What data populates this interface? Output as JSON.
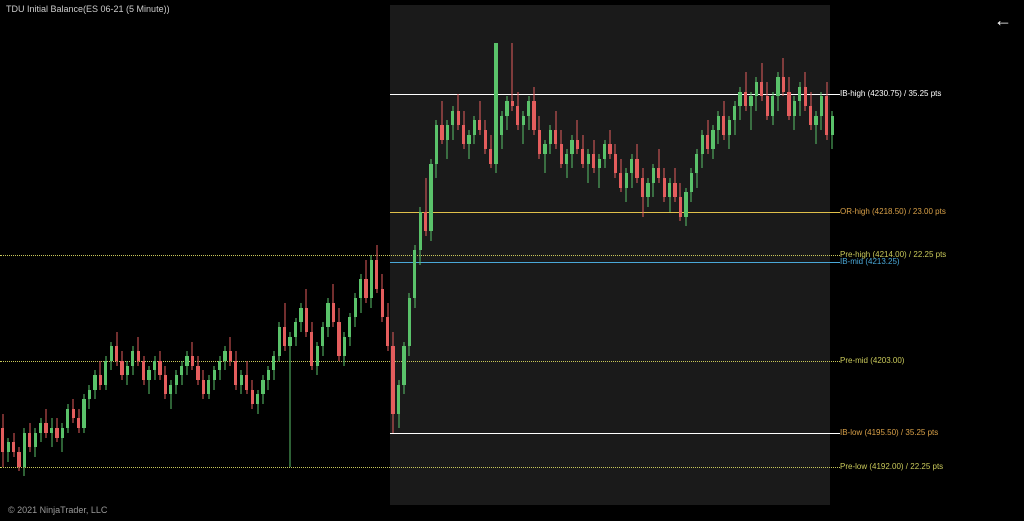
{
  "title": "TDU Initial Balance(ES 06-21 (5 Minute))",
  "copyright": "© 2021 NinjaTrader, LLC",
  "back_icon": "←",
  "chart_data": {
    "type": "candlestick",
    "instrument": "ES 06-21",
    "timeframe": "5 Minute",
    "price_top": 4240.0,
    "price_bottom": 4188.0,
    "session_highlight": {
      "start_idx": 72,
      "end_idx": 152
    },
    "lines": [
      {
        "id": "ib-high",
        "label": "IB-high (4230.75) / 35.25 pts",
        "price": 4230.75,
        "style": "solid",
        "color": "#ffffff",
        "from_idx": 72,
        "to_idx": 160,
        "label_color": "#ffffff"
      },
      {
        "id": "or-high",
        "label": "OR-high (4218.50) / 23.00 pts",
        "price": 4218.5,
        "style": "solid",
        "color": "#e0c04a",
        "from_idx": 72,
        "to_idx": 160,
        "label_color": "#d8a048"
      },
      {
        "id": "pre-high",
        "label": "Pre-high (4214.00) / 22.25 pts",
        "price": 4214.0,
        "style": "dotted",
        "color": "#c9c95a",
        "from_idx": 0,
        "to_idx": 160,
        "label_color": "#c9c95a"
      },
      {
        "id": "ib-mid",
        "label": "IB-mid (4213.25)",
        "price": 4213.25,
        "style": "solid",
        "color": "#4aa8d8",
        "from_idx": 72,
        "to_idx": 160,
        "label_color": "#4aa8d8"
      },
      {
        "id": "pre-mid",
        "label": "Pre-mid (4203.00)",
        "price": 4203.0,
        "style": "dotted",
        "color": "#c9c95a",
        "from_idx": 0,
        "to_idx": 160,
        "label_color": "#c9c95a"
      },
      {
        "id": "ib-low",
        "label": "IB-low (4195.50) / 35.25 pts",
        "price": 4195.5,
        "style": "solid",
        "color": "#ffffff",
        "from_idx": 72,
        "to_idx": 160,
        "label_color": "#d8a048"
      },
      {
        "id": "pre-low",
        "label": "Pre-low (4192.00) / 22.25 pts",
        "price": 4192.0,
        "style": "dotted",
        "color": "#c9c95a",
        "from_idx": 0,
        "to_idx": 160,
        "label_color": "#c9c95a"
      }
    ],
    "candles": [
      {
        "o": 4196.0,
        "h": 4197.5,
        "l": 4192.0,
        "c": 4193.5
      },
      {
        "o": 4193.5,
        "h": 4195.0,
        "l": 4192.5,
        "c": 4194.5
      },
      {
        "o": 4194.5,
        "h": 4195.5,
        "l": 4193.0,
        "c": 4193.5
      },
      {
        "o": 4193.5,
        "h": 4194.0,
        "l": 4191.5,
        "c": 4192.0
      },
      {
        "o": 4192.0,
        "h": 4196.0,
        "l": 4191.0,
        "c": 4195.5
      },
      {
        "o": 4195.5,
        "h": 4196.5,
        "l": 4193.5,
        "c": 4194.0
      },
      {
        "o": 4194.0,
        "h": 4196.0,
        "l": 4193.0,
        "c": 4195.5
      },
      {
        "o": 4195.5,
        "h": 4197.0,
        "l": 4194.5,
        "c": 4196.5
      },
      {
        "o": 4196.5,
        "h": 4198.0,
        "l": 4195.0,
        "c": 4195.5
      },
      {
        "o": 4195.5,
        "h": 4197.0,
        "l": 4194.0,
        "c": 4196.0
      },
      {
        "o": 4196.0,
        "h": 4197.0,
        "l": 4194.5,
        "c": 4195.0
      },
      {
        "o": 4195.0,
        "h": 4196.5,
        "l": 4193.5,
        "c": 4196.0
      },
      {
        "o": 4196.0,
        "h": 4198.5,
        "l": 4195.5,
        "c": 4198.0
      },
      {
        "o": 4198.0,
        "h": 4199.0,
        "l": 4196.5,
        "c": 4197.0
      },
      {
        "o": 4197.0,
        "h": 4198.0,
        "l": 4195.5,
        "c": 4196.0
      },
      {
        "o": 4196.0,
        "h": 4199.5,
        "l": 4195.5,
        "c": 4199.0
      },
      {
        "o": 4199.0,
        "h": 4200.5,
        "l": 4198.0,
        "c": 4200.0
      },
      {
        "o": 4200.0,
        "h": 4202.0,
        "l": 4199.0,
        "c": 4201.5
      },
      {
        "o": 4201.5,
        "h": 4203.0,
        "l": 4200.0,
        "c": 4200.5
      },
      {
        "o": 4200.5,
        "h": 4203.5,
        "l": 4200.0,
        "c": 4203.0
      },
      {
        "o": 4203.0,
        "h": 4205.0,
        "l": 4202.0,
        "c": 4204.5
      },
      {
        "o": 4204.5,
        "h": 4206.0,
        "l": 4202.5,
        "c": 4203.0
      },
      {
        "o": 4203.0,
        "h": 4204.0,
        "l": 4201.0,
        "c": 4201.5
      },
      {
        "o": 4201.5,
        "h": 4203.0,
        "l": 4200.5,
        "c": 4202.5
      },
      {
        "o": 4202.5,
        "h": 4204.5,
        "l": 4201.5,
        "c": 4204.0
      },
      {
        "o": 4204.0,
        "h": 4205.5,
        "l": 4202.5,
        "c": 4203.0
      },
      {
        "o": 4203.0,
        "h": 4203.5,
        "l": 4200.5,
        "c": 4201.0
      },
      {
        "o": 4201.0,
        "h": 4202.5,
        "l": 4199.5,
        "c": 4202.0
      },
      {
        "o": 4202.0,
        "h": 4203.5,
        "l": 4201.0,
        "c": 4203.0
      },
      {
        "o": 4203.0,
        "h": 4204.0,
        "l": 4201.0,
        "c": 4201.5
      },
      {
        "o": 4201.5,
        "h": 4202.5,
        "l": 4199.0,
        "c": 4199.5
      },
      {
        "o": 4199.5,
        "h": 4201.0,
        "l": 4198.0,
        "c": 4200.5
      },
      {
        "o": 4200.5,
        "h": 4202.0,
        "l": 4199.5,
        "c": 4201.5
      },
      {
        "o": 4201.5,
        "h": 4203.0,
        "l": 4200.5,
        "c": 4202.5
      },
      {
        "o": 4202.5,
        "h": 4204.0,
        "l": 4201.5,
        "c": 4203.5
      },
      {
        "o": 4203.5,
        "h": 4205.0,
        "l": 4202.0,
        "c": 4202.5
      },
      {
        "o": 4202.5,
        "h": 4203.5,
        "l": 4200.5,
        "c": 4201.0
      },
      {
        "o": 4201.0,
        "h": 4202.0,
        "l": 4199.0,
        "c": 4199.5
      },
      {
        "o": 4199.5,
        "h": 4201.5,
        "l": 4199.0,
        "c": 4201.0
      },
      {
        "o": 4201.0,
        "h": 4202.5,
        "l": 4200.0,
        "c": 4202.0
      },
      {
        "o": 4202.0,
        "h": 4203.5,
        "l": 4201.0,
        "c": 4203.0
      },
      {
        "o": 4203.0,
        "h": 4204.5,
        "l": 4202.0,
        "c": 4204.0
      },
      {
        "o": 4204.0,
        "h": 4205.5,
        "l": 4202.5,
        "c": 4203.0
      },
      {
        "o": 4203.0,
        "h": 4204.0,
        "l": 4200.0,
        "c": 4200.5
      },
      {
        "o": 4200.5,
        "h": 4202.0,
        "l": 4199.5,
        "c": 4201.5
      },
      {
        "o": 4201.5,
        "h": 4203.0,
        "l": 4199.5,
        "c": 4200.0
      },
      {
        "o": 4200.0,
        "h": 4201.0,
        "l": 4198.0,
        "c": 4198.5
      },
      {
        "o": 4198.5,
        "h": 4200.0,
        "l": 4197.5,
        "c": 4199.5
      },
      {
        "o": 4199.5,
        "h": 4201.5,
        "l": 4198.5,
        "c": 4201.0
      },
      {
        "o": 4201.0,
        "h": 4202.5,
        "l": 4200.0,
        "c": 4202.0
      },
      {
        "o": 4202.0,
        "h": 4204.0,
        "l": 4201.0,
        "c": 4203.5
      },
      {
        "o": 4203.5,
        "h": 4207.0,
        "l": 4203.0,
        "c": 4206.5
      },
      {
        "o": 4206.5,
        "h": 4209.0,
        "l": 4204.0,
        "c": 4204.5
      },
      {
        "o": 4204.5,
        "h": 4206.0,
        "l": 4192.0,
        "c": 4205.5
      },
      {
        "o": 4205.5,
        "h": 4207.5,
        "l": 4204.5,
        "c": 4207.0
      },
      {
        "o": 4207.0,
        "h": 4209.0,
        "l": 4206.0,
        "c": 4208.5
      },
      {
        "o": 4208.5,
        "h": 4210.5,
        "l": 4205.5,
        "c": 4206.0
      },
      {
        "o": 4206.0,
        "h": 4207.0,
        "l": 4202.0,
        "c": 4202.5
      },
      {
        "o": 4202.5,
        "h": 4205.0,
        "l": 4201.5,
        "c": 4204.5
      },
      {
        "o": 4204.5,
        "h": 4207.0,
        "l": 4203.5,
        "c": 4206.5
      },
      {
        "o": 4206.5,
        "h": 4209.5,
        "l": 4205.5,
        "c": 4209.0
      },
      {
        "o": 4209.0,
        "h": 4211.0,
        "l": 4206.5,
        "c": 4207.0
      },
      {
        "o": 4207.0,
        "h": 4208.5,
        "l": 4203.0,
        "c": 4203.5
      },
      {
        "o": 4203.5,
        "h": 4206.0,
        "l": 4202.5,
        "c": 4205.5
      },
      {
        "o": 4205.5,
        "h": 4208.0,
        "l": 4204.5,
        "c": 4207.5
      },
      {
        "o": 4207.5,
        "h": 4210.0,
        "l": 4206.5,
        "c": 4209.5
      },
      {
        "o": 4209.5,
        "h": 4212.0,
        "l": 4208.0,
        "c": 4211.5
      },
      {
        "o": 4211.5,
        "h": 4213.5,
        "l": 4209.0,
        "c": 4209.5
      },
      {
        "o": 4209.5,
        "h": 4214.0,
        "l": 4208.5,
        "c": 4213.5
      },
      {
        "o": 4213.5,
        "h": 4215.0,
        "l": 4210.0,
        "c": 4210.5
      },
      {
        "o": 4210.5,
        "h": 4212.0,
        "l": 4207.0,
        "c": 4207.5
      },
      {
        "o": 4207.5,
        "h": 4209.0,
        "l": 4204.0,
        "c": 4204.5
      },
      {
        "o": 4204.5,
        "h": 4206.0,
        "l": 4195.5,
        "c": 4197.5
      },
      {
        "o": 4197.5,
        "h": 4201.0,
        "l": 4196.0,
        "c": 4200.5
      },
      {
        "o": 4200.5,
        "h": 4205.0,
        "l": 4199.5,
        "c": 4204.5
      },
      {
        "o": 4204.5,
        "h": 4210.0,
        "l": 4203.5,
        "c": 4209.5
      },
      {
        "o": 4209.5,
        "h": 4215.0,
        "l": 4208.5,
        "c": 4214.5
      },
      {
        "o": 4214.5,
        "h": 4219.0,
        "l": 4213.0,
        "c": 4218.5
      },
      {
        "o": 4218.5,
        "h": 4222.0,
        "l": 4216.0,
        "c": 4216.5
      },
      {
        "o": 4216.5,
        "h": 4224.0,
        "l": 4215.5,
        "c": 4223.5
      },
      {
        "o": 4223.5,
        "h": 4228.0,
        "l": 4222.0,
        "c": 4227.5
      },
      {
        "o": 4227.5,
        "h": 4230.0,
        "l": 4225.5,
        "c": 4226.0
      },
      {
        "o": 4226.0,
        "h": 4228.0,
        "l": 4224.0,
        "c": 4227.5
      },
      {
        "o": 4227.5,
        "h": 4229.5,
        "l": 4226.0,
        "c": 4229.0
      },
      {
        "o": 4229.0,
        "h": 4230.75,
        "l": 4227.0,
        "c": 4227.5
      },
      {
        "o": 4227.5,
        "h": 4229.0,
        "l": 4225.0,
        "c": 4225.5
      },
      {
        "o": 4225.5,
        "h": 4227.0,
        "l": 4224.0,
        "c": 4226.5
      },
      {
        "o": 4226.5,
        "h": 4228.5,
        "l": 4225.5,
        "c": 4228.0
      },
      {
        "o": 4228.0,
        "h": 4230.0,
        "l": 4226.5,
        "c": 4227.0
      },
      {
        "o": 4227.0,
        "h": 4228.0,
        "l": 4224.5,
        "c": 4225.0
      },
      {
        "o": 4225.0,
        "h": 4226.5,
        "l": 4223.0,
        "c": 4223.5
      },
      {
        "o": 4223.5,
        "h": 4227.0,
        "l": 4222.5,
        "c": 4236.0
      },
      {
        "o": 4226.5,
        "h": 4229.0,
        "l": 4225.0,
        "c": 4228.5
      },
      {
        "o": 4228.5,
        "h": 4230.5,
        "l": 4227.0,
        "c": 4230.0
      },
      {
        "o": 4230.0,
        "h": 4236.0,
        "l": 4229.0,
        "c": 4229.5
      },
      {
        "o": 4229.5,
        "h": 4231.0,
        "l": 4227.0,
        "c": 4227.5
      },
      {
        "o": 4227.5,
        "h": 4229.0,
        "l": 4225.5,
        "c": 4228.5
      },
      {
        "o": 4228.5,
        "h": 4230.5,
        "l": 4227.0,
        "c": 4230.0
      },
      {
        "o": 4230.0,
        "h": 4231.5,
        "l": 4226.5,
        "c": 4227.0
      },
      {
        "o": 4227.0,
        "h": 4228.5,
        "l": 4224.0,
        "c": 4224.5
      },
      {
        "o": 4224.5,
        "h": 4226.0,
        "l": 4222.5,
        "c": 4225.5
      },
      {
        "o": 4225.5,
        "h": 4227.5,
        "l": 4224.5,
        "c": 4227.0
      },
      {
        "o": 4227.0,
        "h": 4229.0,
        "l": 4225.0,
        "c": 4225.5
      },
      {
        "o": 4225.5,
        "h": 4227.0,
        "l": 4223.0,
        "c": 4223.5
      },
      {
        "o": 4223.5,
        "h": 4225.0,
        "l": 4222.0,
        "c": 4224.5
      },
      {
        "o": 4224.5,
        "h": 4226.5,
        "l": 4223.0,
        "c": 4226.0
      },
      {
        "o": 4226.0,
        "h": 4228.0,
        "l": 4224.5,
        "c": 4225.0
      },
      {
        "o": 4225.0,
        "h": 4226.5,
        "l": 4223.0,
        "c": 4223.5
      },
      {
        "o": 4223.5,
        "h": 4225.0,
        "l": 4221.5,
        "c": 4224.5
      },
      {
        "o": 4224.5,
        "h": 4226.0,
        "l": 4222.5,
        "c": 4223.0
      },
      {
        "o": 4223.0,
        "h": 4224.5,
        "l": 4221.0,
        "c": 4224.0
      },
      {
        "o": 4224.0,
        "h": 4226.0,
        "l": 4223.0,
        "c": 4225.5
      },
      {
        "o": 4225.5,
        "h": 4227.0,
        "l": 4224.0,
        "c": 4224.5
      },
      {
        "o": 4224.5,
        "h": 4225.5,
        "l": 4222.0,
        "c": 4222.5
      },
      {
        "o": 4222.5,
        "h": 4224.0,
        "l": 4220.5,
        "c": 4221.0
      },
      {
        "o": 4221.0,
        "h": 4223.0,
        "l": 4219.5,
        "c": 4222.5
      },
      {
        "o": 4222.5,
        "h": 4224.5,
        "l": 4221.0,
        "c": 4224.0
      },
      {
        "o": 4224.0,
        "h": 4225.5,
        "l": 4221.5,
        "c": 4222.0
      },
      {
        "o": 4222.0,
        "h": 4223.0,
        "l": 4218.0,
        "c": 4220.0
      },
      {
        "o": 4220.0,
        "h": 4222.0,
        "l": 4219.0,
        "c": 4221.5
      },
      {
        "o": 4221.5,
        "h": 4223.5,
        "l": 4220.0,
        "c": 4223.0
      },
      {
        "o": 4223.0,
        "h": 4225.0,
        "l": 4221.5,
        "c": 4222.0
      },
      {
        "o": 4222.0,
        "h": 4223.0,
        "l": 4219.5,
        "c": 4220.0
      },
      {
        "o": 4220.0,
        "h": 4222.0,
        "l": 4218.5,
        "c": 4221.5
      },
      {
        "o": 4221.5,
        "h": 4223.0,
        "l": 4219.5,
        "c": 4220.0
      },
      {
        "o": 4220.0,
        "h": 4221.5,
        "l": 4217.5,
        "c": 4218.0
      },
      {
        "o": 4218.0,
        "h": 4221.0,
        "l": 4217.0,
        "c": 4220.5
      },
      {
        "o": 4220.5,
        "h": 4223.0,
        "l": 4219.5,
        "c": 4222.5
      },
      {
        "o": 4222.5,
        "h": 4225.0,
        "l": 4221.0,
        "c": 4224.5
      },
      {
        "o": 4224.5,
        "h": 4227.0,
        "l": 4223.0,
        "c": 4226.5
      },
      {
        "o": 4226.5,
        "h": 4228.0,
        "l": 4224.5,
        "c": 4225.0
      },
      {
        "o": 4225.0,
        "h": 4227.5,
        "l": 4224.0,
        "c": 4227.0
      },
      {
        "o": 4227.0,
        "h": 4229.0,
        "l": 4225.5,
        "c": 4228.5
      },
      {
        "o": 4228.5,
        "h": 4230.0,
        "l": 4226.0,
        "c": 4226.5
      },
      {
        "o": 4226.5,
        "h": 4228.5,
        "l": 4225.0,
        "c": 4228.0
      },
      {
        "o": 4228.0,
        "h": 4230.0,
        "l": 4226.5,
        "c": 4229.5
      },
      {
        "o": 4229.5,
        "h": 4231.5,
        "l": 4228.0,
        "c": 4231.0
      },
      {
        "o": 4231.0,
        "h": 4233.0,
        "l": 4229.0,
        "c": 4229.5
      },
      {
        "o": 4229.5,
        "h": 4231.0,
        "l": 4227.0,
        "c": 4230.5
      },
      {
        "o": 4230.5,
        "h": 4232.5,
        "l": 4229.0,
        "c": 4232.0
      },
      {
        "o": 4232.0,
        "h": 4234.0,
        "l": 4230.0,
        "c": 4230.5
      },
      {
        "o": 4230.5,
        "h": 4232.0,
        "l": 4228.0,
        "c": 4228.5
      },
      {
        "o": 4228.5,
        "h": 4231.0,
        "l": 4227.5,
        "c": 4230.5
      },
      {
        "o": 4230.5,
        "h": 4233.0,
        "l": 4229.0,
        "c": 4232.5
      },
      {
        "o": 4232.5,
        "h": 4234.5,
        "l": 4230.5,
        "c": 4231.0
      },
      {
        "o": 4231.0,
        "h": 4232.5,
        "l": 4228.0,
        "c": 4228.5
      },
      {
        "o": 4228.5,
        "h": 4230.5,
        "l": 4227.0,
        "c": 4230.0
      },
      {
        "o": 4230.0,
        "h": 4232.0,
        "l": 4228.5,
        "c": 4231.5
      },
      {
        "o": 4231.5,
        "h": 4233.0,
        "l": 4229.0,
        "c": 4229.5
      },
      {
        "o": 4229.5,
        "h": 4231.0,
        "l": 4227.0,
        "c": 4227.5
      },
      {
        "o": 4227.5,
        "h": 4229.0,
        "l": 4225.5,
        "c": 4228.5
      },
      {
        "o": 4228.5,
        "h": 4231.0,
        "l": 4227.0,
        "c": 4230.5
      },
      {
        "o": 4230.5,
        "h": 4232.0,
        "l": 4226.0,
        "c": 4226.5
      },
      {
        "o": 4226.5,
        "h": 4229.0,
        "l": 4225.0,
        "c": 4228.5
      }
    ]
  }
}
